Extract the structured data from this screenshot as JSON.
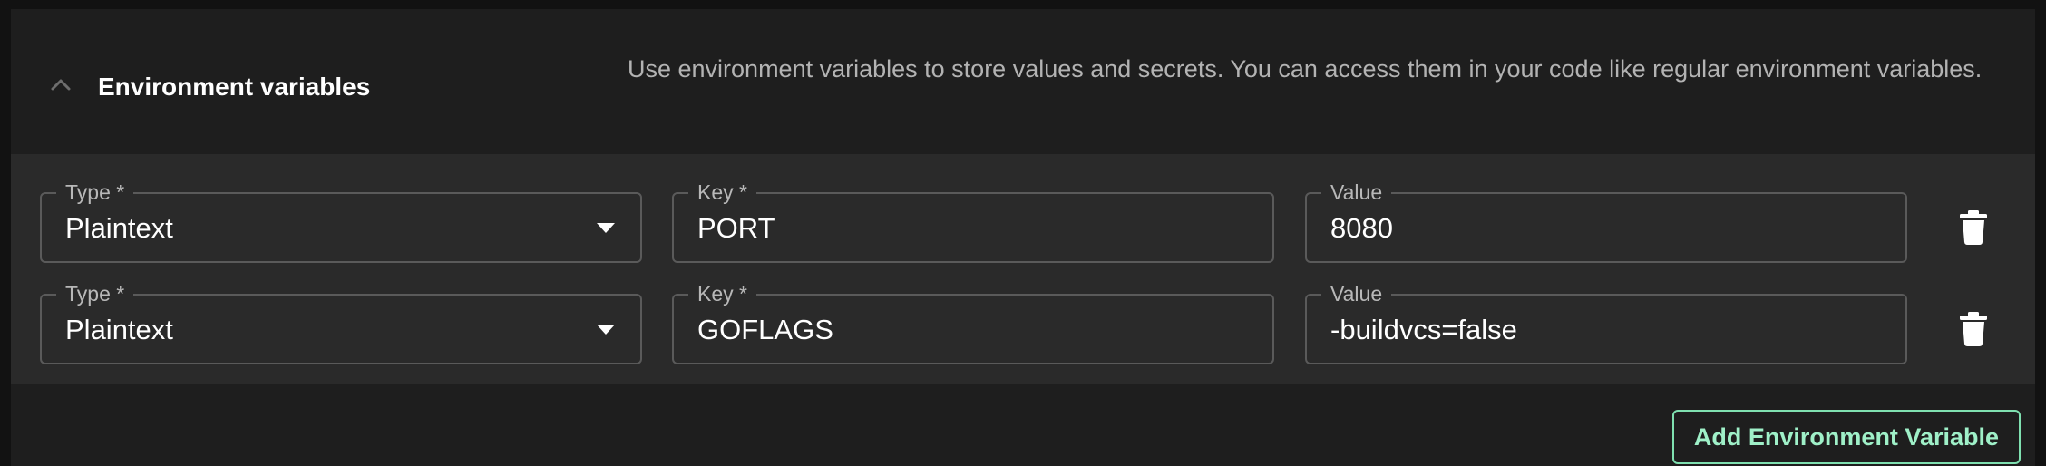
{
  "section": {
    "title": "Environment variables",
    "description": "Use environment variables to store values and secrets. You can access them in your code like regular environment variables.",
    "collapse_icon": "chevron-up-icon"
  },
  "env_vars": [
    {
      "type_label": "Type *",
      "type_value": "Plaintext",
      "key_label": "Key *",
      "key_value": "PORT",
      "value_label": "Value",
      "value_value": "8080",
      "delete_icon": "trash-icon"
    },
    {
      "type_label": "Type *",
      "type_value": "Plaintext",
      "key_label": "Key *",
      "key_value": "GOFLAGS",
      "value_label": "Value",
      "value_value": "-buildvcs=false",
      "delete_icon": "trash-icon"
    }
  ],
  "actions": {
    "add_label": "Add Environment Variable"
  },
  "colors": {
    "panel_bg": "#1e1e1e",
    "rows_bg": "#2a2a2a",
    "accent": "#9ff0c8"
  }
}
